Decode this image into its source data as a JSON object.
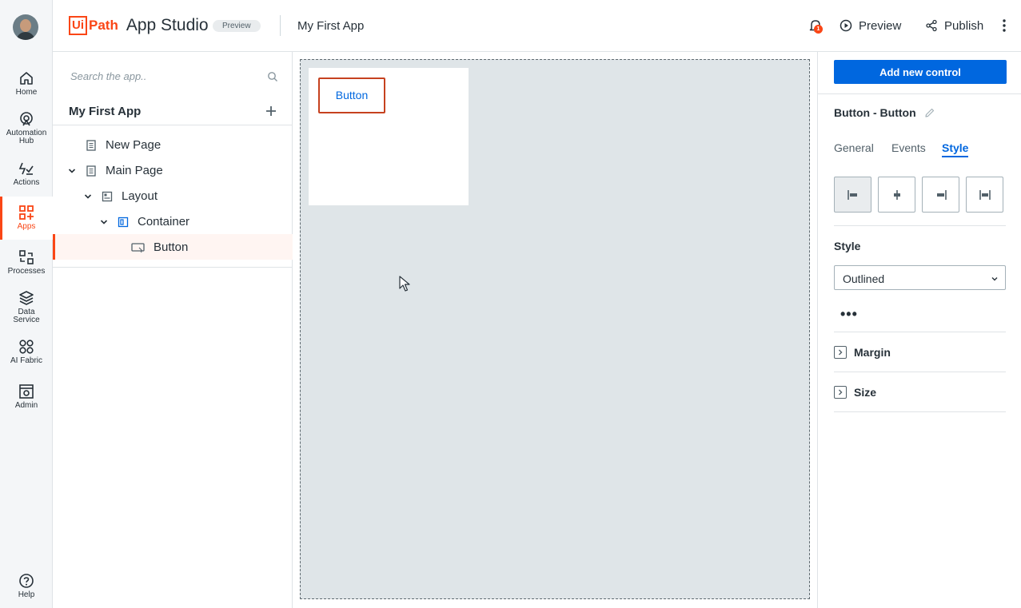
{
  "rail": {
    "items": [
      {
        "label": "Home",
        "icon": "home-icon"
      },
      {
        "label": "Automation Hub",
        "icon": "automation-hub-icon"
      },
      {
        "label": "Actions",
        "icon": "actions-icon"
      },
      {
        "label": "Apps",
        "icon": "apps-icon",
        "active": true
      },
      {
        "label": "Processes",
        "icon": "processes-icon"
      },
      {
        "label": "Data Service",
        "icon": "data-service-icon"
      },
      {
        "label": "AI Fabric",
        "icon": "ai-fabric-icon"
      },
      {
        "label": "Admin",
        "icon": "admin-icon"
      }
    ],
    "help_label": "Help"
  },
  "header": {
    "logo_ui": "Ui",
    "logo_path": "Path",
    "product": "App Studio",
    "chip": "Preview",
    "app_title": "My First App",
    "notification_count": "1",
    "preview_label": "Preview",
    "publish_label": "Publish"
  },
  "tree": {
    "search_placeholder": "Search the app..",
    "title": "My First App",
    "nodes": [
      {
        "label": "New Page"
      },
      {
        "label": "Main Page"
      },
      {
        "label": "Layout"
      },
      {
        "label": "Container"
      },
      {
        "label": "Button",
        "selected": true
      }
    ]
  },
  "canvas": {
    "button_label": "Button"
  },
  "props": {
    "add_control_label": "Add new control",
    "control_name": "Button - Button",
    "tabs": [
      "General",
      "Events",
      "Style"
    ],
    "active_tab": "Style",
    "style_label": "Style",
    "style_value": "Outlined",
    "sections": [
      "Margin",
      "Size"
    ]
  },
  "colors": {
    "accent": "#fa4616",
    "primary": "#0067df",
    "selection_outline": "#c6411f"
  }
}
